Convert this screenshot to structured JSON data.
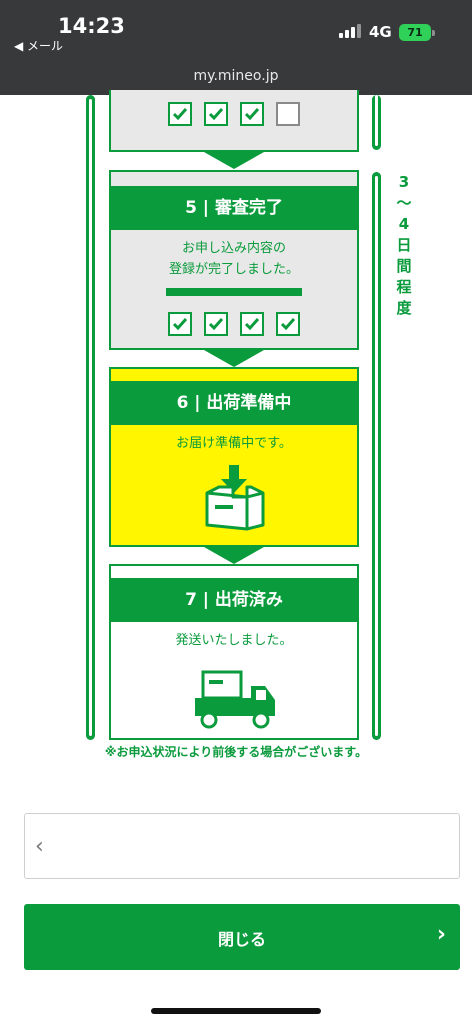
{
  "status_bar": {
    "time": "14:23",
    "back_app": "◀ メール",
    "network": "4G",
    "battery": "71"
  },
  "browser": {
    "url": "my.mineo.jp"
  },
  "side_label": [
    "3",
    "〜",
    "4",
    "日",
    "間",
    "程",
    "度"
  ],
  "steps": [
    {
      "header": "5 | 審査完了",
      "text_lines": [
        "お申し込み内容の",
        "登録が完了しました。"
      ]
    },
    {
      "header": "6 | 出荷準備中",
      "text_lines": [
        "お届け準備中です。"
      ]
    },
    {
      "header": "7 | 出荷済み",
      "text_lines": [
        "発送いたしました。"
      ]
    }
  ],
  "note": "※お申込状況により前後する場合がございます。",
  "buttons": {
    "back_icon": "‹",
    "close_label": "閉じる",
    "close_icon": "›"
  },
  "colors": {
    "brand_green": "#0a9b3c",
    "highlight_yellow": "#fff600",
    "card_grey": "#e8e8e8",
    "topbar": "#37393a"
  }
}
